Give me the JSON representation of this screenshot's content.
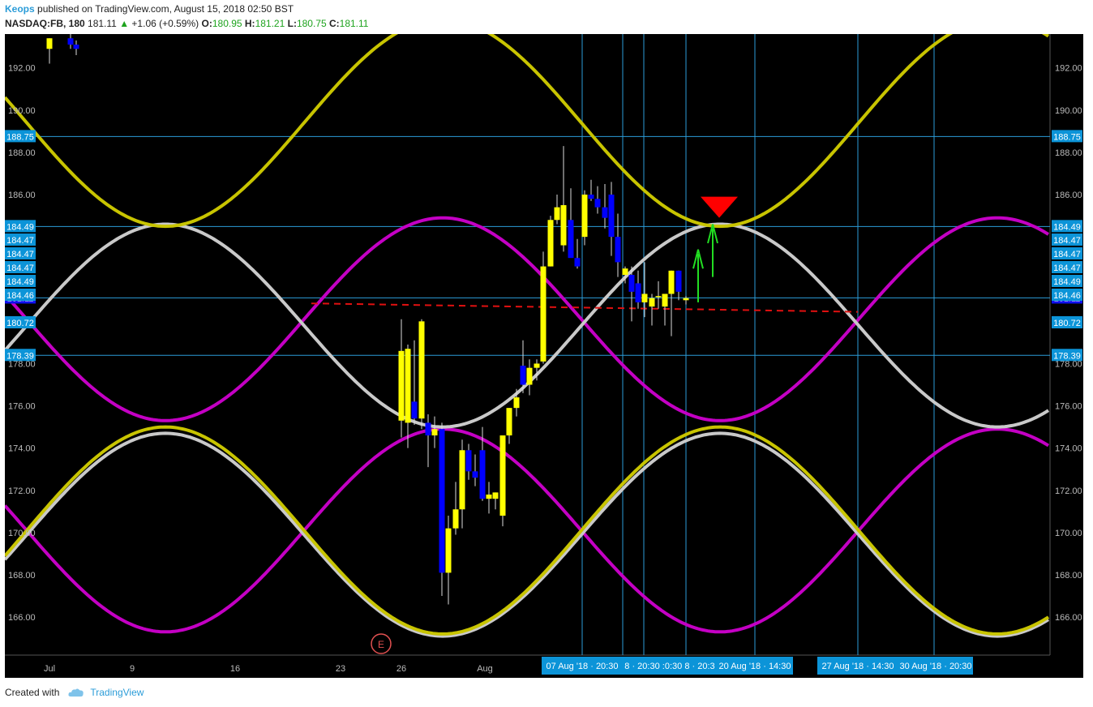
{
  "header": {
    "user": "Keops",
    "published_text": "published on TradingView.com, August 15, 2018 02:50 BST",
    "symbol": "NASDAQ:FB, 180",
    "last": "181.11",
    "change": "+1.06 (+0.59%)",
    "o_label": "O:",
    "o_value": "180.95",
    "h_label": "H:",
    "h_value": "181.21",
    "l_label": "L:",
    "l_value": "180.75",
    "c_label": "C:",
    "c_value": "181.11"
  },
  "footer": {
    "created_with": "Created with",
    "brand": "TradingView"
  },
  "colors": {
    "background": "#000000",
    "up_candle": "#ffff00",
    "down_candle": "#0000ff",
    "grid_line": "#2b9cd8",
    "label_bg": "#0c94d8",
    "yellow_wave": "#c8c400",
    "white_wave": "#c9c9c9",
    "magenta_wave": "#c400c4",
    "arrow": "#22dd22",
    "marker": "#ff0000",
    "dashed": "#e01010"
  },
  "chart_data": {
    "type": "candlestick",
    "ylim": [
      164.2,
      193.6
    ],
    "y_ticks": [
      "166.00",
      "168.00",
      "170.00",
      "172.00",
      "174.00",
      "176.00",
      "178.00",
      "180.00",
      "182.00",
      "184.00",
      "186.00",
      "188.00",
      "190.00",
      "192.00"
    ],
    "x_ticks": [
      "Jul",
      "9",
      "16",
      "23",
      "26",
      "Aug"
    ],
    "horizontal_levels": [
      {
        "label": "188.75",
        "value": 188.75
      },
      {
        "label": "184.49",
        "value": 184.49
      },
      {
        "label": "181.11",
        "value": 181.11,
        "current": true
      },
      {
        "label": "178.39",
        "value": 178.39
      }
    ],
    "stacked_labels": [
      "184.47",
      "184.47",
      "184.47",
      "184.49",
      "184.46",
      "180.72"
    ],
    "time_labels": [
      "07 Aug '18 · 20:30",
      "8 · 20:30",
      ":0:30",
      "8 · 20:3",
      "20 Aug '18 · 14:30",
      "27 Aug '18 · 14:30",
      "30 Aug '18 · 20:30"
    ],
    "event_marker": "E",
    "candles": [
      {
        "o": 192.9,
        "h": 193.4,
        "l": 192.2,
        "c": 193.4
      },
      {
        "o": 193.4,
        "h": 193.6,
        "l": 192.9,
        "c": 193.1
      },
      {
        "o": 193.1,
        "h": 193.3,
        "l": 192.6,
        "c": 192.9
      },
      {
        "o": 175.3,
        "h": 180.1,
        "l": 174.5,
        "c": 178.6
      },
      {
        "o": 175.2,
        "h": 178.9,
        "l": 174.0,
        "c": 178.7
      },
      {
        "o": 176.2,
        "h": 179.1,
        "l": 175.1,
        "c": 175.4
      },
      {
        "o": 175.4,
        "h": 180.1,
        "l": 174.9,
        "c": 180.0
      },
      {
        "o": 175.2,
        "h": 175.6,
        "l": 173.1,
        "c": 174.6
      },
      {
        "o": 174.6,
        "h": 175.5,
        "l": 174.0,
        "c": 174.9
      },
      {
        "o": 174.9,
        "h": 175.2,
        "l": 167.0,
        "c": 168.1
      },
      {
        "o": 168.1,
        "h": 170.8,
        "l": 166.6,
        "c": 170.2
      },
      {
        "o": 170.2,
        "h": 172.4,
        "l": 169.9,
        "c": 171.1
      },
      {
        "o": 171.1,
        "h": 174.4,
        "l": 170.2,
        "c": 173.9
      },
      {
        "o": 173.9,
        "h": 174.2,
        "l": 172.5,
        "c": 172.9
      },
      {
        "o": 172.9,
        "h": 173.7,
        "l": 172.2,
        "c": 172.6
      },
      {
        "o": 173.9,
        "h": 175.0,
        "l": 171.5,
        "c": 171.6
      },
      {
        "o": 171.6,
        "h": 172.4,
        "l": 170.9,
        "c": 171.8
      },
      {
        "o": 171.6,
        "h": 171.9,
        "l": 171.1,
        "c": 171.9
      },
      {
        "o": 170.8,
        "h": 171.2,
        "l": 170.3,
        "c": 174.6
      },
      {
        "o": 174.6,
        "h": 175.9,
        "l": 174.2,
        "c": 175.9
      },
      {
        "o": 175.9,
        "h": 176.8,
        "l": 175.5,
        "c": 176.4
      },
      {
        "o": 177.9,
        "h": 179.1,
        "l": 176.6,
        "c": 177.0
      },
      {
        "o": 177.0,
        "h": 178.2,
        "l": 176.5,
        "c": 177.8
      },
      {
        "o": 177.8,
        "h": 178.2,
        "l": 177.2,
        "c": 178.0
      },
      {
        "o": 178.1,
        "h": 183.3,
        "l": 178.0,
        "c": 182.6
      },
      {
        "o": 182.6,
        "h": 185.0,
        "l": 182.6,
        "c": 184.8
      },
      {
        "o": 184.8,
        "h": 186.0,
        "l": 184.6,
        "c": 185.4
      },
      {
        "o": 183.6,
        "h": 188.3,
        "l": 183.3,
        "c": 185.5
      },
      {
        "o": 184.8,
        "h": 186.3,
        "l": 183.9,
        "c": 183.0
      },
      {
        "o": 183.0,
        "h": 183.9,
        "l": 182.5,
        "c": 182.6
      },
      {
        "o": 184.0,
        "h": 186.2,
        "l": 183.6,
        "c": 186.0
      },
      {
        "o": 186.0,
        "h": 186.7,
        "l": 185.7,
        "c": 185.8
      },
      {
        "o": 185.8,
        "h": 186.4,
        "l": 185.1,
        "c": 185.4
      },
      {
        "o": 185.4,
        "h": 186.5,
        "l": 184.4,
        "c": 184.9
      },
      {
        "o": 186.0,
        "h": 186.6,
        "l": 183.1,
        "c": 184.0
      },
      {
        "o": 184.0,
        "h": 185.1,
        "l": 182.1,
        "c": 182.8
      },
      {
        "o": 182.2,
        "h": 182.6,
        "l": 181.8,
        "c": 182.5
      },
      {
        "o": 182.2,
        "h": 182.6,
        "l": 180.0,
        "c": 181.4
      },
      {
        "o": 181.8,
        "h": 182.4,
        "l": 180.6,
        "c": 180.9
      },
      {
        "o": 180.9,
        "h": 182.8,
        "l": 180.2,
        "c": 181.3
      },
      {
        "o": 180.7,
        "h": 181.3,
        "l": 179.8,
        "c": 181.1
      },
      {
        "o": 181.2,
        "h": 181.9,
        "l": 180.6,
        "c": 181.2
      },
      {
        "o": 180.7,
        "h": 181.3,
        "l": 179.8,
        "c": 181.3
      },
      {
        "o": 181.3,
        "h": 182.4,
        "l": 179.3,
        "c": 182.4
      },
      {
        "o": 182.4,
        "h": 182.4,
        "l": 181.0,
        "c": 181.4
      },
      {
        "o": 181.0,
        "h": 181.2,
        "l": 180.8,
        "c": 181.1
      }
    ]
  }
}
